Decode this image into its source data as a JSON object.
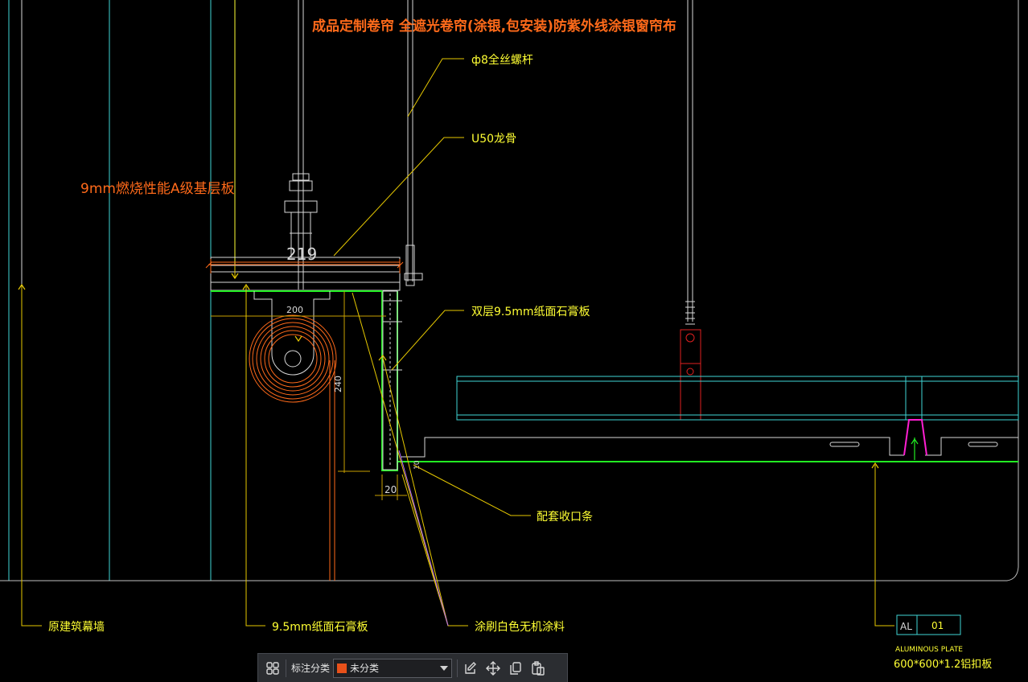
{
  "drawing": {
    "title": "成品定制卷帘 全遮光卷帘(涂银,包安装)防紫外线涂银窗帘布",
    "label_a_board": "9mm燃烧性能A级基层板",
    "label_rod": "ф8全丝螺杆",
    "label_keel": "U50龙骨",
    "label_double_gypsum": "双层9.5mm纸面石膏板",
    "label_trim": "配套收口条",
    "label_curtain_wall": "原建筑幕墙",
    "label_gypsum": "9.5mm纸面石膏板",
    "label_paint": "涂刷白色无机涂料",
    "dim_219": "219",
    "dim_200": "200",
    "dim_240": "240",
    "dim_20": "20",
    "dim_10": "10",
    "tag_al": "AL",
    "tag_num": "01",
    "tag_plate_en": "ALUMINOUS PLATE",
    "tag_plate_cn": "600*600*1.2铝扣板"
  },
  "colors": {
    "background": "#000000",
    "cyan": "#3fd6d6",
    "yellow": "#ffff33",
    "orange": "#ff6a1a",
    "green": "#22ee22",
    "red": "#e02020",
    "magenta": "#ff1fd2",
    "white": "#d9d9d9",
    "annotation": "#e6c800"
  },
  "toolbar": {
    "grid_icon": "grid-icon",
    "category_label": "标注分类",
    "category_value": "未分类",
    "category_color": "#e8511a",
    "edit_icon": "edit-icon",
    "move_icon": "move-icon",
    "copy_icon": "copy-icon",
    "paste_icon": "paste-icon"
  }
}
